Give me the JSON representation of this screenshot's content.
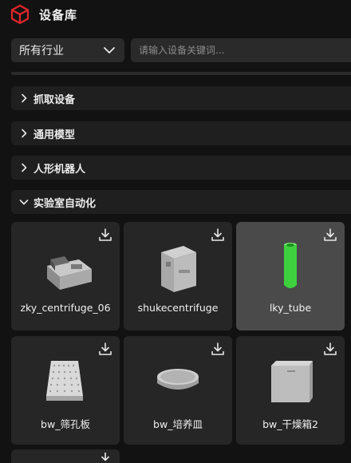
{
  "header": {
    "title": "设备库",
    "logo_icon": "red-cube-icon"
  },
  "filters": {
    "industry_select": "所有行业",
    "search_placeholder": "请输入设备关键词..."
  },
  "categories": [
    {
      "label": "抓取设备",
      "expanded": false
    },
    {
      "label": "通用模型",
      "expanded": false
    },
    {
      "label": "人形机器人",
      "expanded": false
    },
    {
      "label": "实验室自动化",
      "expanded": true
    }
  ],
  "devices": [
    {
      "name": "zky_centrifuge_06",
      "thumb": "centrifuge-machine"
    },
    {
      "name": "shukecentrifuge",
      "thumb": "centrifuge-tower"
    },
    {
      "name": "lky_tube",
      "thumb": "green-tube",
      "selected": true
    },
    {
      "name": "bw_筛孔板",
      "thumb": "well-plate"
    },
    {
      "name": "bw_培养皿",
      "thumb": "petri-dish"
    },
    {
      "name": "bw_干燥箱2",
      "thumb": "drying-box"
    }
  ],
  "colors": {
    "accent": "#e0262c",
    "selected_card": "#4a4a4a",
    "tube_green": "#3ed13e"
  }
}
